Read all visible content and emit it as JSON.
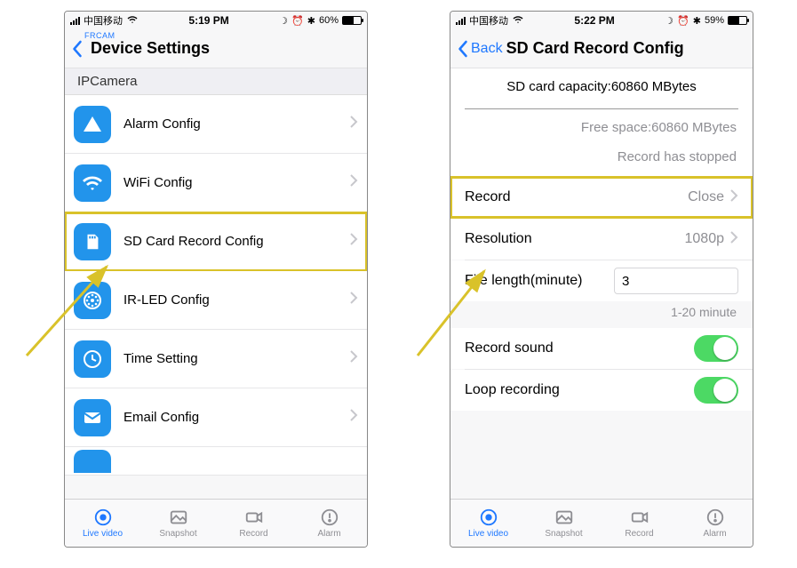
{
  "left": {
    "status": {
      "carrier": "中国移动",
      "time": "5:19 PM",
      "battery_pct": "60%"
    },
    "nav": {
      "frcam_overlay": "FRCAM",
      "title": "Device Settings"
    },
    "section_header": "IPCamera",
    "items": [
      {
        "label": "Alarm Config",
        "icon": "alert-triangle-icon"
      },
      {
        "label": "WiFi Config",
        "icon": "wifi-icon"
      },
      {
        "label": "SD Card Record Config",
        "icon": "sd-card-icon",
        "highlight": true
      },
      {
        "label": "IR-LED Config",
        "icon": "gear-dots-icon"
      },
      {
        "label": "Time Setting",
        "icon": "clock-icon"
      },
      {
        "label": "Email Config",
        "icon": "mail-icon"
      }
    ]
  },
  "right": {
    "status": {
      "carrier": "中国移动",
      "time": "5:22 PM",
      "battery_pct": "59%"
    },
    "nav": {
      "back_label": "Back",
      "title": "SD Card Record Config"
    },
    "capacity_line": "SD card capacity:60860 MBytes",
    "free_line": "Free space:60860 MBytes",
    "status_line": "Record has stopped",
    "rows": {
      "record": {
        "label": "Record",
        "value": "Close"
      },
      "resolution": {
        "label": "Resolution",
        "value": "1080p"
      },
      "file_len": {
        "label": "File length(minute)",
        "value": "3"
      },
      "hint": "1-20 minute",
      "sound": {
        "label": "Record sound",
        "on": true
      },
      "loop": {
        "label": "Loop recording",
        "on": true
      }
    }
  },
  "tabs": [
    {
      "label": "Live video",
      "icon": "live-video-icon",
      "active": true
    },
    {
      "label": "Snapshot",
      "icon": "snapshot-icon"
    },
    {
      "label": "Record",
      "icon": "record-icon"
    },
    {
      "label": "Alarm",
      "icon": "alarm-icon"
    }
  ]
}
